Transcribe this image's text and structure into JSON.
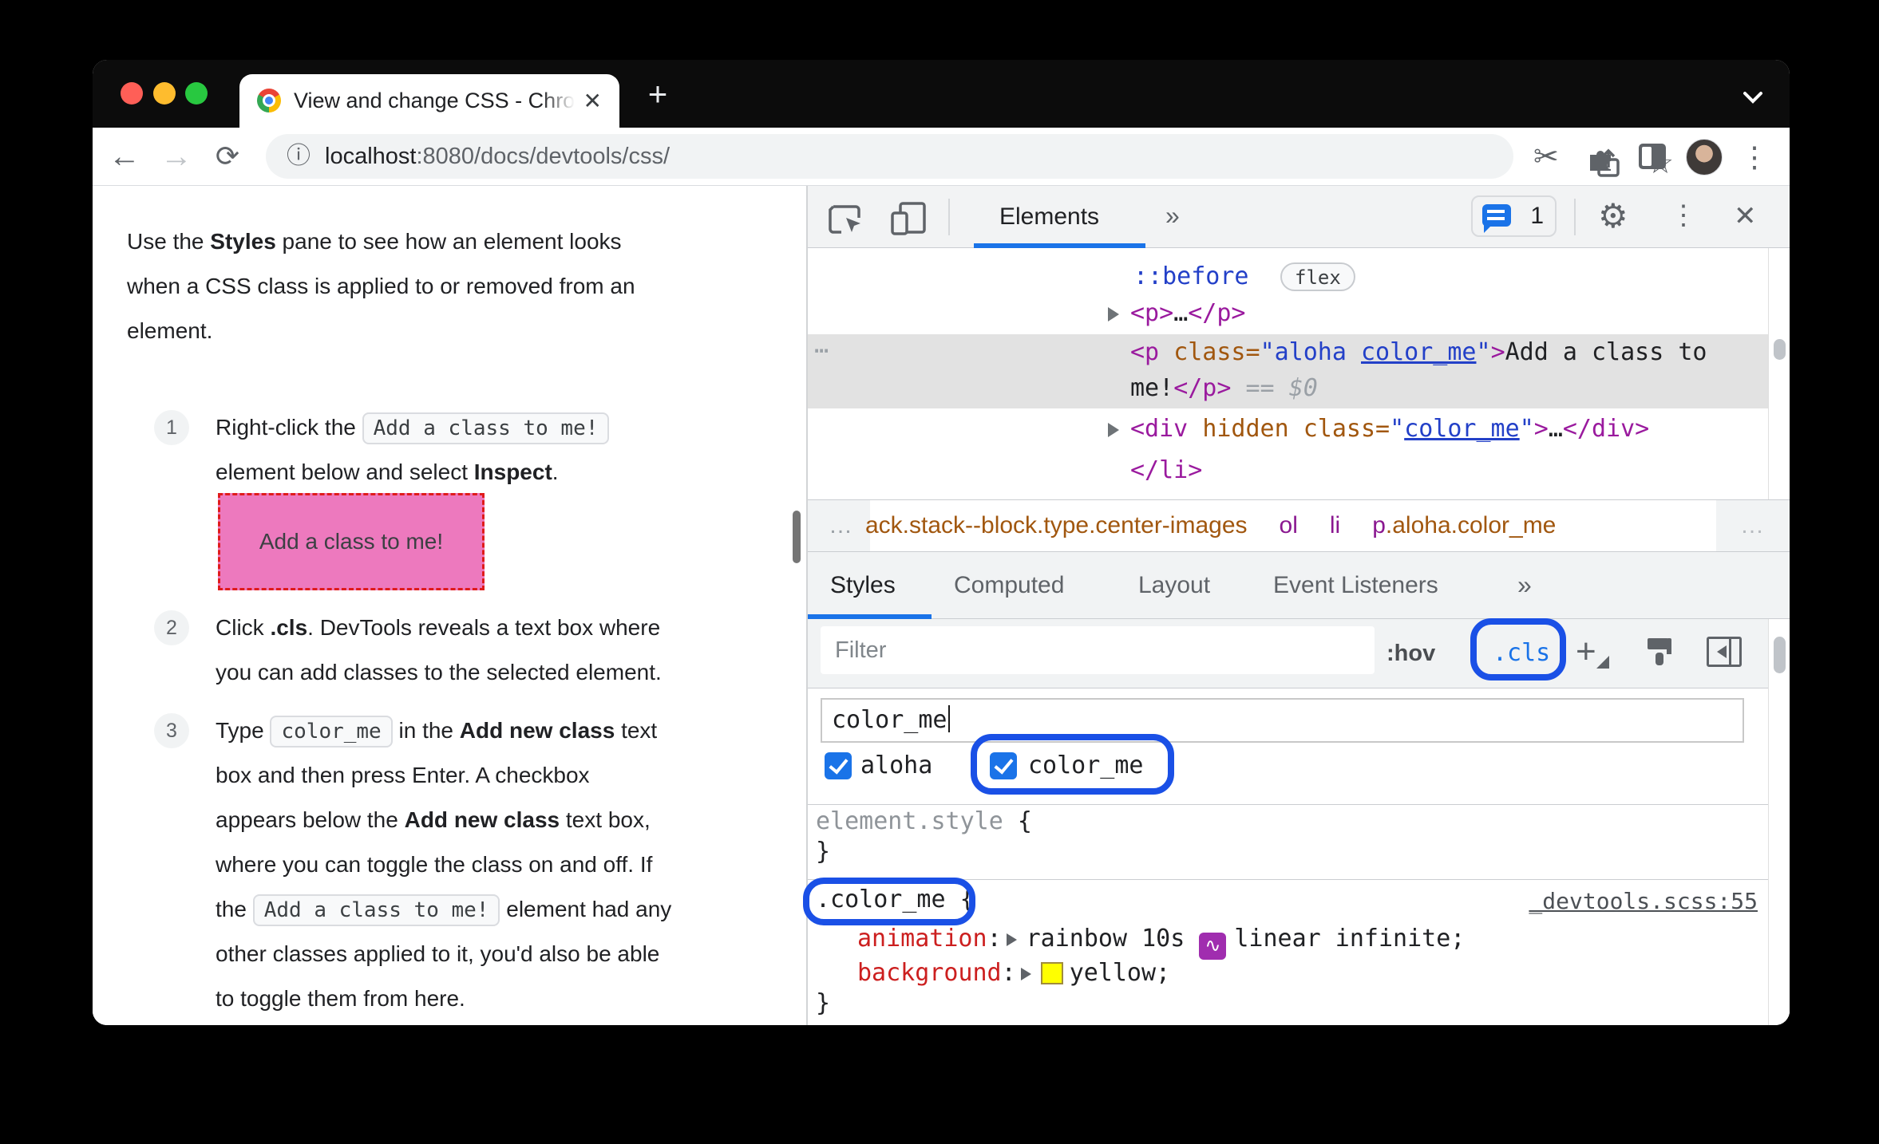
{
  "window": {
    "tab": {
      "title": "View and change CSS - Chrom",
      "close_glyph": "✕",
      "new_tab_glyph": "+"
    },
    "traffic_colors": {
      "red": "#ff5f57",
      "yellow": "#febc2e",
      "green": "#28c840"
    },
    "urlbar": {
      "host": "localhost",
      "rest": ":8080/docs/devtools/css/"
    },
    "toolbar_glyphs": {
      "back": "←",
      "forward": "→",
      "reload": "⟳",
      "info": "ⓘ",
      "star": "☆",
      "scissors": "✂",
      "menu": "⋮"
    }
  },
  "article": {
    "intro_lines": [
      [
        {
          "t": "Use the "
        },
        {
          "t": "Styles",
          "c": "b"
        },
        {
          "t": " pane to see how an element looks"
        }
      ],
      [
        {
          "t": "when a CSS class is applied to or removed from an"
        }
      ],
      [
        {
          "t": "element."
        }
      ]
    ],
    "steps": [
      {
        "num": "1",
        "lines": [
          [
            {
              "t": "Right-click the "
            },
            {
              "t": "Add a class to me!",
              "c": "code"
            }
          ],
          [
            {
              "t": "element below and select "
            },
            {
              "t": "Inspect",
              "c": "b"
            },
            {
              "t": "."
            }
          ]
        ]
      },
      {
        "num": "2",
        "lines": [
          [
            {
              "t": "Click "
            },
            {
              "t": ".cls",
              "c": "b"
            },
            {
              "t": ". DevTools reveals a text box where"
            }
          ],
          [
            {
              "t": "you can add classes to the selected element."
            }
          ]
        ]
      },
      {
        "num": "3",
        "lines": [
          [
            {
              "t": "Type "
            },
            {
              "t": "color_me",
              "c": "code"
            },
            {
              "t": " in the "
            },
            {
              "t": "Add new class",
              "c": "b"
            },
            {
              "t": " text"
            }
          ],
          [
            {
              "t": "box and then press Enter. A checkbox"
            }
          ],
          [
            {
              "t": "appears below the "
            },
            {
              "t": "Add new class",
              "c": "b"
            },
            {
              "t": " text box,"
            }
          ],
          [
            {
              "t": "where you can toggle the class on and off. If"
            }
          ],
          [
            {
              "t": "the "
            },
            {
              "t": "Add a class to me!",
              "c": "code"
            },
            {
              "t": " element had any"
            }
          ],
          [
            {
              "t": "other classes applied to it, you'd also be able"
            }
          ],
          [
            {
              "t": "to toggle them from here."
            }
          ]
        ]
      }
    ],
    "demo_box_text": "Add a class to me!"
  },
  "devtools": {
    "toolbar": {
      "panel_tab": "Elements",
      "more_tabs": "»",
      "messages_count": "1",
      "close_glyph": "✕",
      "gear_glyph": "⚙",
      "menu_glyph": "⋮"
    },
    "dom": {
      "pseudo_row": [
        {
          "t": "::before",
          "c": "val"
        }
      ],
      "flex_badge": "flex",
      "p_collapsed": [
        {
          "t": "<p>",
          "c": "tag"
        },
        {
          "t": "…",
          "c": "plain"
        },
        {
          "t": "</p>",
          "c": "tag"
        }
      ],
      "more_dots": "⋯",
      "selected_line1": [
        {
          "t": "<p ",
          "c": "tag"
        },
        {
          "t": "class=",
          "c": "attr"
        },
        {
          "t": "\"aloha ",
          "c": "val"
        },
        {
          "t": "color_me",
          "c": "val u"
        },
        {
          "t": "\"",
          "c": "val"
        },
        {
          "t": ">",
          "c": "tag"
        },
        {
          "t": "Add a class to",
          "c": "plain"
        }
      ],
      "selected_line2": [
        {
          "t": "me!",
          "c": "plain"
        },
        {
          "t": "</p>",
          "c": "tag"
        },
        {
          "t": " == ",
          "c": "gray"
        },
        {
          "t": "$0",
          "c": "gray i"
        }
      ],
      "div_row": [
        {
          "t": "<div ",
          "c": "tag"
        },
        {
          "t": "hidden class=",
          "c": "attr"
        },
        {
          "t": "\"",
          "c": "val"
        },
        {
          "t": "color_me",
          "c": "val u"
        },
        {
          "t": "\"",
          "c": "val"
        },
        {
          "t": ">",
          "c": "tag"
        },
        {
          "t": "…",
          "c": "plain"
        },
        {
          "t": "</div>",
          "c": "tag"
        }
      ],
      "li_close": [
        {
          "t": "</li>",
          "c": "tag"
        }
      ]
    },
    "breadcrumbs": [
      {
        "t": "ack.stack--block.type.center-images",
        "c": "bc-cls"
      },
      {
        "t": "ol",
        "c": "bc-tag"
      },
      {
        "t": "li",
        "c": "bc-tag"
      },
      {
        "t": "p",
        "c": "bc-tag"
      },
      {
        "t": ".aloha.color_me",
        "c": "bc-cls glue"
      }
    ],
    "breadcrumb_overflow": {
      "left": "…",
      "right": "…"
    },
    "sidebar_tabs": {
      "styles": "Styles",
      "computed": "Computed",
      "layout": "Layout",
      "event_listeners": "Event Listeners",
      "more": "»"
    },
    "filter": {
      "placeholder": "Filter",
      "hov_label": ":hov",
      "cls_label": ".cls",
      "new_rule_glyph": "+"
    },
    "class_editor": {
      "input_value": "color_me",
      "checkboxes": [
        {
          "label": "aloha",
          "checked": true
        },
        {
          "label": "color_me",
          "checked": true
        }
      ]
    },
    "rules": {
      "inline": {
        "selector_line": [
          {
            "t": "element.style",
            "c": "dim"
          },
          {
            "t": " {",
            "c": "plain"
          }
        ],
        "close": "}"
      },
      "color_me": {
        "selector_line": [
          {
            "t": ".color_me",
            "c": "plain"
          },
          {
            "t": " {",
            "c": "plain"
          }
        ],
        "source_link": "_devtools.scss:55",
        "props": [
          [
            {
              "t": "animation",
              "c": "prop"
            },
            {
              "t": ":",
              "c": "plain"
            },
            {
              "c": "icon-arrow"
            },
            {
              "t": "rainbow 10s ",
              "c": "plain"
            },
            {
              "c": "icon-bezier"
            },
            {
              "t": "linear infinite;",
              "c": "plain"
            }
          ],
          [
            {
              "t": "background",
              "c": "prop"
            },
            {
              "t": ":",
              "c": "plain"
            },
            {
              "c": "icon-arrow"
            },
            {
              "c": "icon-swatch"
            },
            {
              "t": "yellow;",
              "c": "plain"
            }
          ]
        ],
        "close": "}"
      }
    },
    "colors": {
      "accent_blue": "#1a73e8",
      "annotation_blue": "#1a50e6",
      "selection_gray": "#e2e2e2",
      "swatch_yellow": "#ffff00"
    }
  }
}
